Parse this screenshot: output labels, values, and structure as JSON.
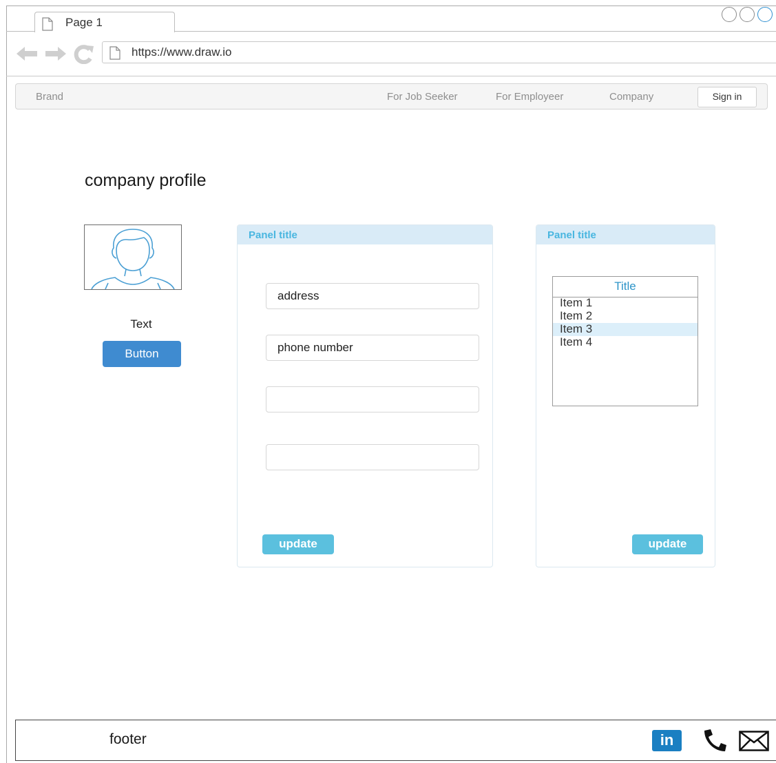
{
  "browser": {
    "tab_label": "Page 1",
    "url": "https://www.draw.io"
  },
  "navbar": {
    "brand": "Brand",
    "links": [
      "For Job Seeker",
      "For Employeer",
      "Company"
    ],
    "sign_in": "Sign in"
  },
  "page": {
    "title": "company profile"
  },
  "profile": {
    "caption": "Text",
    "button": "Button"
  },
  "panel_left": {
    "title": "Panel title",
    "fields": [
      "address",
      "phone number",
      "",
      ""
    ],
    "update": "update"
  },
  "panel_right": {
    "title": "Panel title",
    "list_title": "Title",
    "items": [
      "Item 1",
      "Item 2",
      "Item 3",
      "Item 4"
    ],
    "selected_item": "Item 3",
    "update": "update"
  },
  "footer": {
    "text": "footer",
    "linkedin": "in",
    "icons": [
      "linkedin-icon",
      "phone-icon",
      "mail-icon"
    ]
  },
  "colors": {
    "primary_button": "#3f8bd0",
    "update_button": "#5bc0de",
    "panel_header": "#d9ebf7",
    "panel_title": "#49b6e0",
    "list_selected": "#dceffa",
    "linkedin": "#1a7fc2"
  }
}
